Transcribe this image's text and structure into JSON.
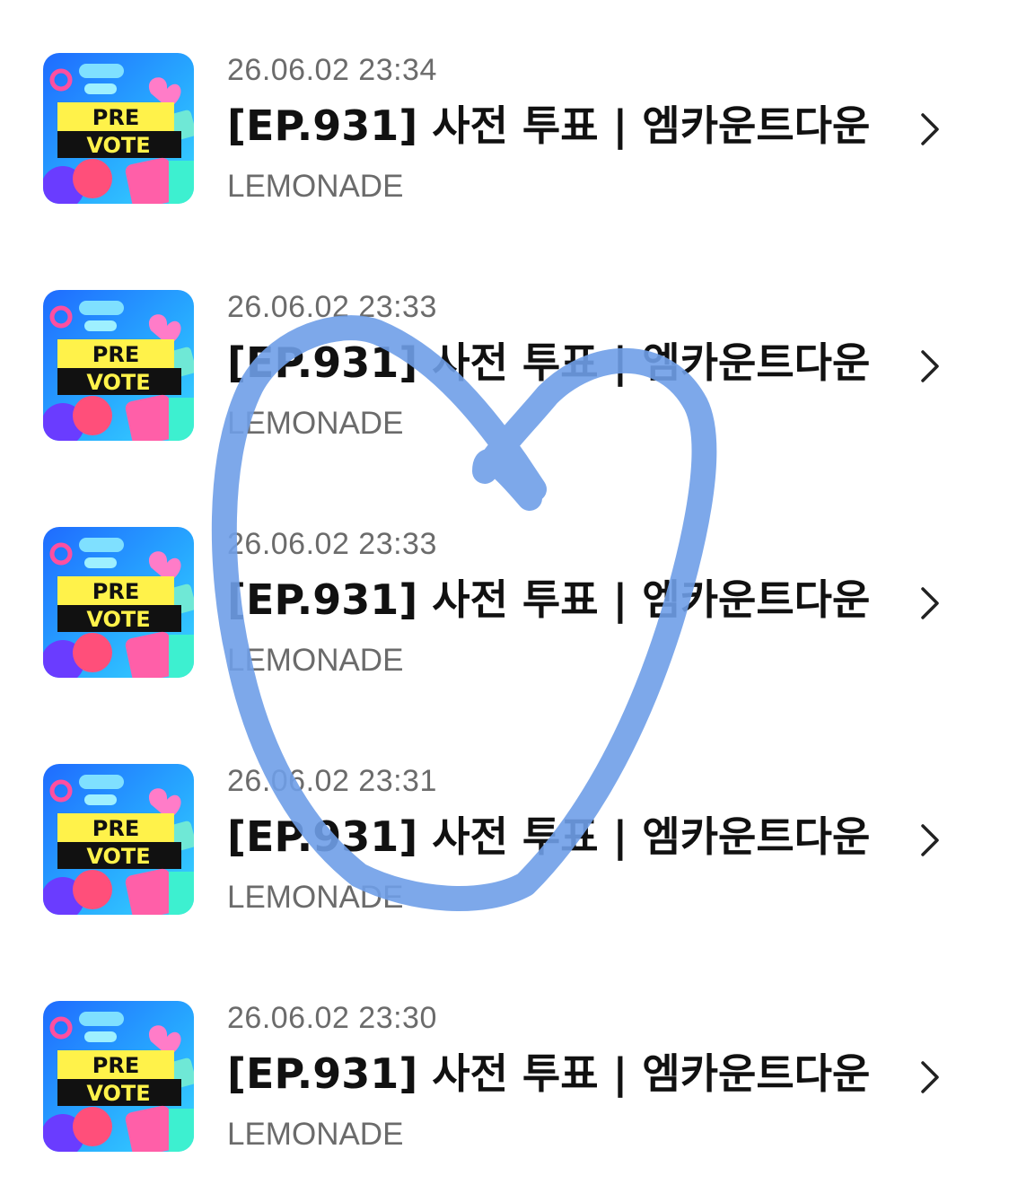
{
  "items": [
    {
      "timestamp": "26.06.02 23:34",
      "title": "[EP.931] 사전 투표 | 엠카운트다운",
      "channel": "LEMONADE",
      "thumb_line1": "PRE",
      "thumb_line2": "VOTE"
    },
    {
      "timestamp": "26.06.02 23:33",
      "title": "[EP.931] 사전 투표 | 엠카운트다운",
      "channel": "LEMONADE",
      "thumb_line1": "PRE",
      "thumb_line2": "VOTE"
    },
    {
      "timestamp": "26.06.02 23:33",
      "title": "[EP.931] 사전 투표 | 엠카운트다운",
      "channel": "LEMONADE",
      "thumb_line1": "PRE",
      "thumb_line2": "VOTE"
    },
    {
      "timestamp": "26.06.02 23:31",
      "title": "[EP.931] 사전 투표 | 엠카운트다운",
      "channel": "LEMONADE",
      "thumb_line1": "PRE",
      "thumb_line2": "VOTE"
    },
    {
      "timestamp": "26.06.02 23:30",
      "title": "[EP.931] 사전 투표 | 엠카운트다운",
      "channel": "LEMONADE",
      "thumb_line1": "PRE",
      "thumb_line2": "VOTE"
    }
  ],
  "icons": {
    "row_arrow": "chevron-right-icon",
    "overlay": "hand-drawn-heart"
  },
  "colors": {
    "heart_stroke": "#6f9fe8",
    "thumb_yellow": "#fff24a",
    "thumb_blue": "#2a8cff",
    "thumb_pink": "#ff4fa0"
  }
}
